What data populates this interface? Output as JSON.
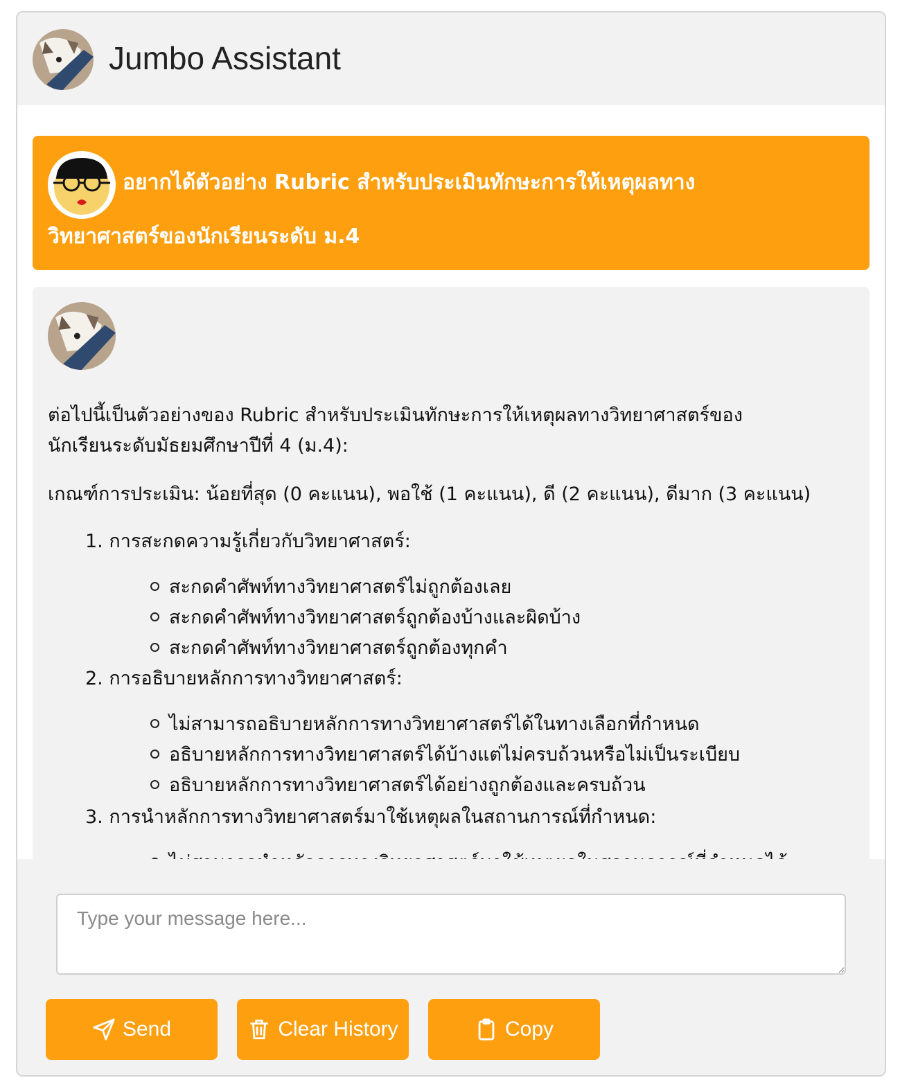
{
  "header": {
    "title": "Jumbo Assistant"
  },
  "user_message": {
    "line1": "อยากได้ตัวอย่าง Rubric สำหรับประเมินทักษะการให้เหตุผลทาง",
    "line2": "วิทยาศาสตร์ของนักเรียนระดับ ม.4"
  },
  "bot_message": {
    "intro_line1": "ต่อไปนี้เป็นตัวอย่างของ Rubric สำหรับประเมินทักษะการให้เหตุผลทางวิทยาศาสตร์ของ",
    "intro_line2": "นักเรียนระดับมัธยมศึกษาปีที่ 4 (ม.4):",
    "criteria": "เกณฑ์การประเมิน: น้อยที่สุด (0 คะแนน), พอใช้ (1 คะแนน), ดี (2 คะแนน), ดีมาก (3 คะแนน)",
    "items": [
      {
        "label": "1. การสะกดความรู้เกี่ยวกับวิทยาศาสตร์:",
        "subs": [
          "สะกดคำศัพท์ทางวิทยาศาสตร์ไม่ถูกต้องเลย",
          "สะกดคำศัพท์ทางวิทยาศาสตร์ถูกต้องบ้างและผิดบ้าง",
          "สะกดคำศัพท์ทางวิทยาศาสตร์ถูกต้องทุกคำ"
        ]
      },
      {
        "label": "2. การอธิบายหลักการทางวิทยาศาสตร์:",
        "subs": [
          "ไม่สามารถอธิบายหลักการทางวิทยาศาสตร์ได้ในทางเลือกที่กำหนด",
          "อธิบายหลักการทางวิทยาศาสตร์ได้บ้างแต่ไม่ครบถ้วนหรือไม่เป็นระเบียบ",
          "อธิบายหลักการทางวิทยาศาสตร์ได้อย่างถูกต้องและครบถ้วน"
        ]
      },
      {
        "label": "3. การนำหลักการทางวิทยาศาสตร์มาใช้เหตุผลในสถานการณ์ที่กำหนด:",
        "subs": [
          "ไม่สามารถนำหลักการทางวิทยาศาสตร์มาใช้เหตุผลในสถานการณ์ที่กำหนดได้"
        ]
      }
    ]
  },
  "input": {
    "placeholder": "Type your message here..."
  },
  "buttons": {
    "send": "Send",
    "clear": "Clear History",
    "copy": "Copy"
  },
  "colors": {
    "accent": "#fe9f10",
    "background": "#f2f2f2"
  }
}
